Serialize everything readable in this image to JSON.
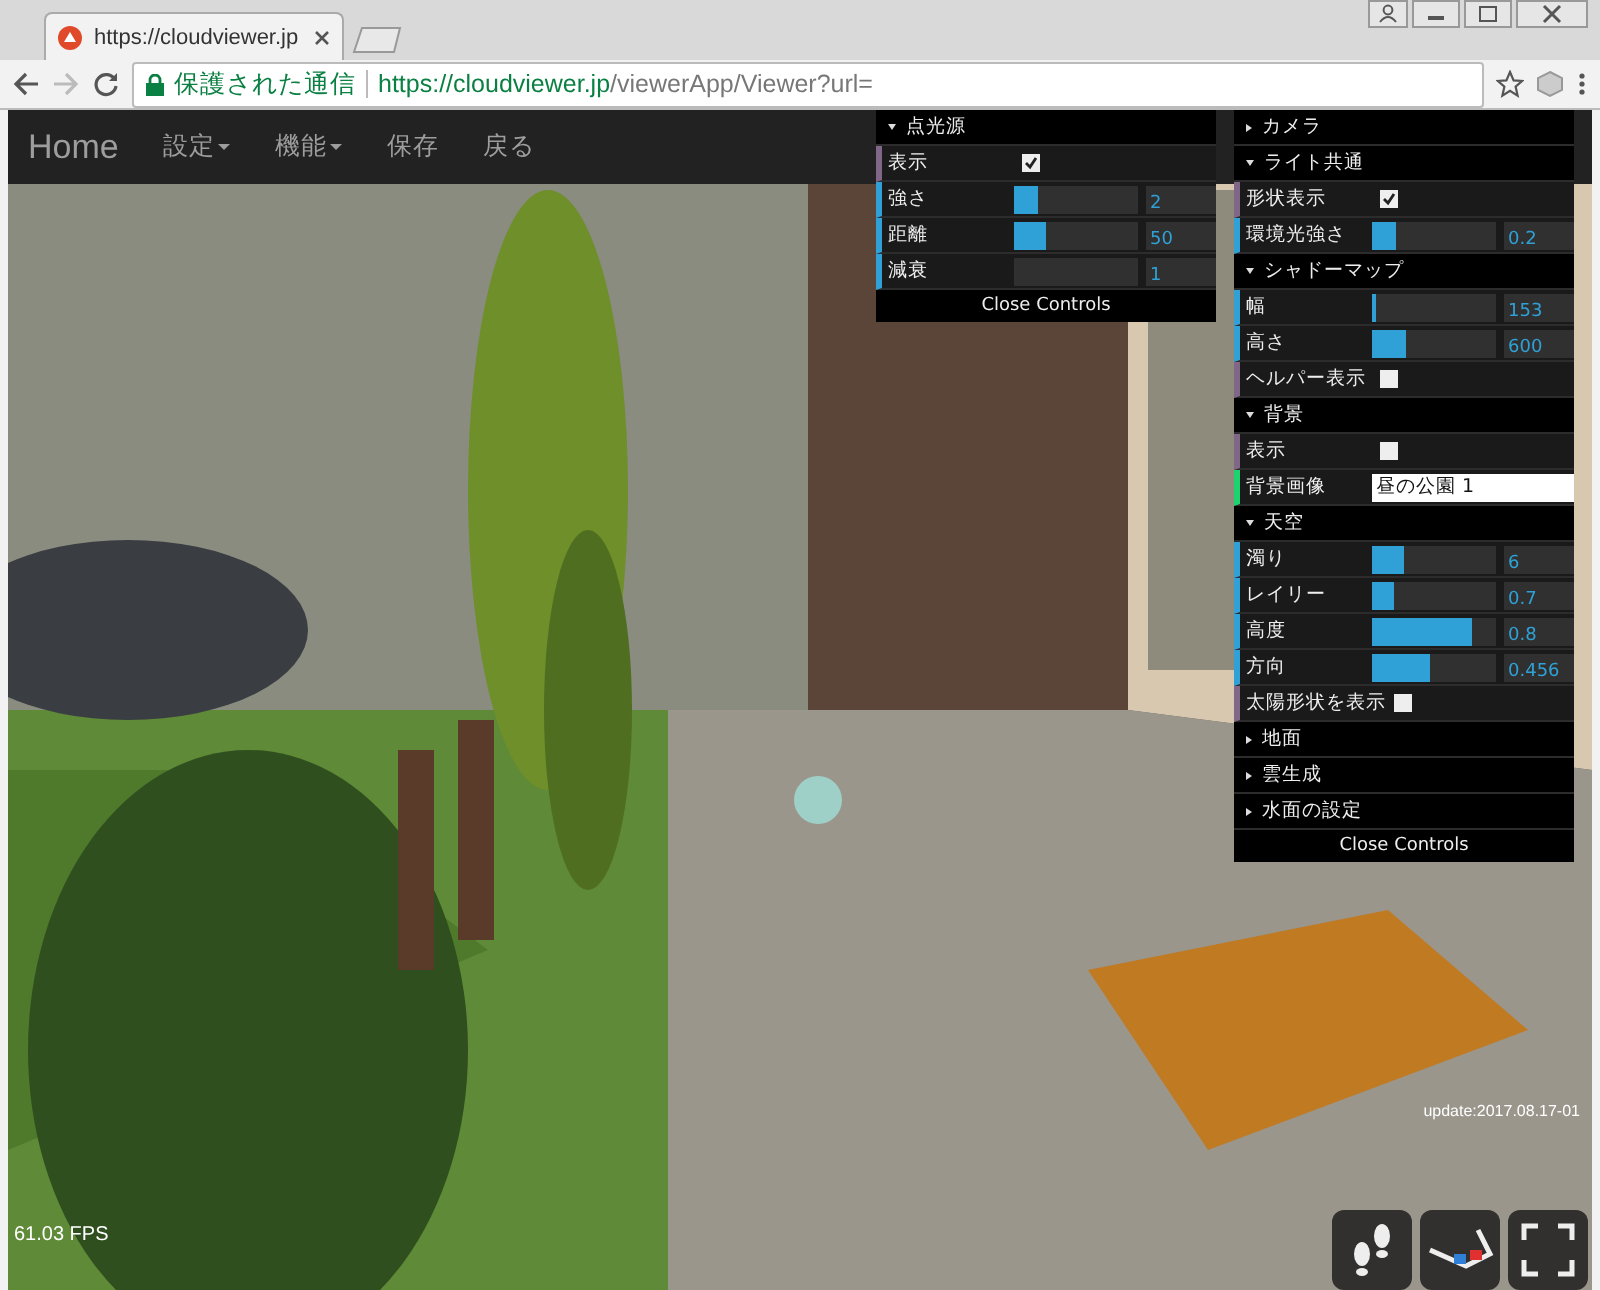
{
  "browser": {
    "tab_title": "https://cloudviewer.jp",
    "secure_label": "保護された通信",
    "url_host": "https://cloudviewer.jp",
    "url_path": "/viewerApp/Viewer?url="
  },
  "navbar": {
    "brand": "Home",
    "items": [
      {
        "label": "設定",
        "dropdown": true
      },
      {
        "label": "機能",
        "dropdown": true
      },
      {
        "label": "保存",
        "dropdown": false
      },
      {
        "label": "戻る",
        "dropdown": false
      }
    ]
  },
  "panels": [
    {
      "close_label": "Close Controls",
      "folders": [
        {
          "title": "点光源",
          "expanded": true,
          "controls": [
            {
              "kind": "boolean",
              "label": "表示",
              "checked": true
            },
            {
              "kind": "number",
              "label": "強さ",
              "level": 0.2,
              "value": "2"
            },
            {
              "kind": "number",
              "label": "距離",
              "level": 0.25,
              "value": "50"
            },
            {
              "kind": "number",
              "label": "減衰",
              "level": 0,
              "value": "1"
            }
          ]
        }
      ]
    },
    {
      "close_label": "Close Controls",
      "folders": [
        {
          "title": "カメラ",
          "expanded": false
        },
        {
          "title": "ライト共通",
          "expanded": true,
          "controls": [
            {
              "kind": "boolean",
              "label": "形状表示",
              "checked": true
            },
            {
              "kind": "number",
              "label": "環境光強さ",
              "level": 0.2,
              "value": "0.2"
            }
          ]
        },
        {
          "title": "シャドーマップ",
          "expanded": true,
          "controls": [
            {
              "kind": "number",
              "label": "幅",
              "level": 0.04,
              "value": "153"
            },
            {
              "kind": "number",
              "label": "高さ",
              "level": 0.28,
              "value": "600"
            },
            {
              "kind": "boolean",
              "label": "ヘルパー表示",
              "checked": false
            }
          ]
        },
        {
          "title": "背景",
          "expanded": true,
          "controls": [
            {
              "kind": "boolean",
              "label": "表示",
              "checked": false
            },
            {
              "kind": "string",
              "label": "背景画像",
              "value": "昼の公園 1"
            }
          ]
        },
        {
          "title": "天空",
          "expanded": true,
          "controls": [
            {
              "kind": "number",
              "label": "濁り",
              "level": 0.25,
              "value": "6"
            },
            {
              "kind": "number",
              "label": "レイリー",
              "level": 0.17,
              "value": "0.7"
            },
            {
              "kind": "number",
              "label": "高度",
              "level": 0.8,
              "value": "0.8"
            },
            {
              "kind": "number",
              "label": "方向",
              "level": 0.46,
              "value": "0.456"
            },
            {
              "kind": "boolean",
              "label": "太陽形状を表示",
              "checked": false
            }
          ]
        },
        {
          "title": "地面",
          "expanded": false
        },
        {
          "title": "雲生成",
          "expanded": false
        },
        {
          "title": "水面の設定",
          "expanded": false
        }
      ]
    }
  ],
  "fps": "61.03 FPS",
  "update": "update:2017.08.17-01"
}
